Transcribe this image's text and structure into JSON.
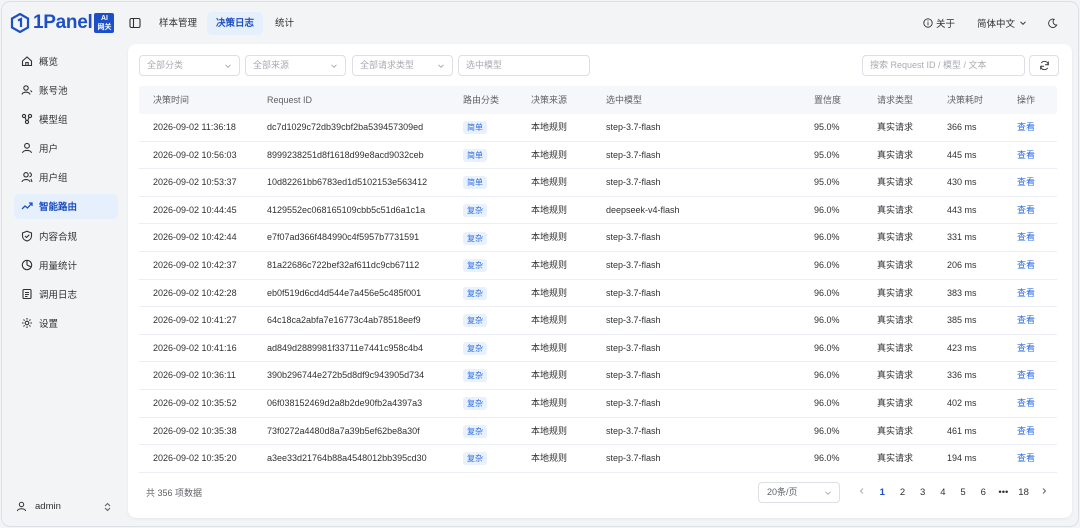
{
  "brand": {
    "name": "1Panel",
    "badge_line1": "AI",
    "badge_line2": "网关"
  },
  "sidebar": {
    "items": [
      {
        "label": "概览",
        "icon": "home-icon"
      },
      {
        "label": "账号池",
        "icon": "account-pool-icon"
      },
      {
        "label": "模型组",
        "icon": "model-group-icon"
      },
      {
        "label": "用户",
        "icon": "user-icon"
      },
      {
        "label": "用户组",
        "icon": "user-group-icon"
      },
      {
        "label": "智能路由",
        "icon": "smart-route-icon",
        "active": true
      },
      {
        "label": "内容合规",
        "icon": "shield-icon"
      },
      {
        "label": "用量统计",
        "icon": "pie-chart-icon"
      },
      {
        "label": "调用日志",
        "icon": "log-icon"
      },
      {
        "label": "设置",
        "icon": "gear-icon"
      }
    ],
    "user": "admin"
  },
  "header": {
    "tabs": [
      {
        "label": "样本管理",
        "active": false
      },
      {
        "label": "决策日志",
        "active": true
      },
      {
        "label": "统计",
        "active": false
      }
    ],
    "about": "关于",
    "language": "简体中文"
  },
  "filters": {
    "category": "全部分类",
    "source": "全部来源",
    "request_type": "全部请求类型",
    "model": "选中模型",
    "search_placeholder": "搜索 Request ID / 模型 / 文本"
  },
  "table": {
    "columns": [
      "决策时间",
      "Request ID",
      "路由分类",
      "决策来源",
      "选中模型",
      "置信度",
      "请求类型",
      "决策耗时",
      "操作"
    ],
    "rows": [
      [
        "2026-09-02 11:36:18",
        "dc7d1029c72db39cbf2ba539457309ed",
        "简单",
        "本地规则",
        "step-3.7-flash",
        "95.0%",
        "真实请求",
        "366 ms",
        "查看"
      ],
      [
        "2026-09-02 10:56:03",
        "8999238251d8f1618d99e8acd9032ceb",
        "简单",
        "本地规则",
        "step-3.7-flash",
        "95.0%",
        "真实请求",
        "445 ms",
        "查看"
      ],
      [
        "2026-09-02 10:53:37",
        "10d82261bb6783ed1d5102153e563412",
        "简单",
        "本地规则",
        "step-3.7-flash",
        "95.0%",
        "真实请求",
        "430 ms",
        "查看"
      ],
      [
        "2026-09-02 10:44:45",
        "4129552ec068165109cbb5c51d6a1c1a",
        "复杂",
        "本地规则",
        "deepseek-v4-flash",
        "96.0%",
        "真实请求",
        "443 ms",
        "查看"
      ],
      [
        "2026-09-02 10:42:44",
        "e7f07ad366f484990c4f5957b7731591",
        "复杂",
        "本地规则",
        "step-3.7-flash",
        "96.0%",
        "真实请求",
        "331 ms",
        "查看"
      ],
      [
        "2026-09-02 10:42:37",
        "81a22686c722bef32af611dc9cb67112",
        "复杂",
        "本地规则",
        "step-3.7-flash",
        "96.0%",
        "真实请求",
        "206 ms",
        "查看"
      ],
      [
        "2026-09-02 10:42:28",
        "eb0f519d6cd4d544e7a456e5c485f001",
        "复杂",
        "本地规则",
        "step-3.7-flash",
        "96.0%",
        "真实请求",
        "383 ms",
        "查看"
      ],
      [
        "2026-09-02 10:41:27",
        "64c18ca2abfa7e16773c4ab78518eef9",
        "复杂",
        "本地规则",
        "step-3.7-flash",
        "96.0%",
        "真实请求",
        "385 ms",
        "查看"
      ],
      [
        "2026-09-02 10:41:16",
        "ad849d2889981f33711e7441c958c4b4",
        "复杂",
        "本地规则",
        "step-3.7-flash",
        "96.0%",
        "真实请求",
        "423 ms",
        "查看"
      ],
      [
        "2026-09-02 10:36:11",
        "390b296744e272b5d8df9c943905d734",
        "复杂",
        "本地规则",
        "step-3.7-flash",
        "96.0%",
        "真实请求",
        "336 ms",
        "查看"
      ],
      [
        "2026-09-02 10:35:52",
        "06f038152469d2a8b2de90fb2a4397a3",
        "复杂",
        "本地规则",
        "step-3.7-flash",
        "96.0%",
        "真实请求",
        "402 ms",
        "查看"
      ],
      [
        "2026-09-02 10:35:38",
        "73f0272a4480d8a7a39b5ef62be8a30f",
        "复杂",
        "本地规则",
        "step-3.7-flash",
        "96.0%",
        "真实请求",
        "461 ms",
        "查看"
      ],
      [
        "2026-09-02 10:35:20",
        "a3ee33d21764b88a4548012bb395cd30",
        "复杂",
        "本地规则",
        "step-3.7-flash",
        "96.0%",
        "真实请求",
        "194 ms",
        "查看"
      ]
    ]
  },
  "footer": {
    "total": "共 356 项数据",
    "page_size": "20条/页",
    "pages": [
      "1",
      "2",
      "3",
      "4",
      "5",
      "6",
      "•••",
      "18"
    ],
    "current_page": "1"
  },
  "colors": {
    "accent": "#1d50c4",
    "link": "#2b6de0",
    "active_bg": "#e6effc"
  }
}
